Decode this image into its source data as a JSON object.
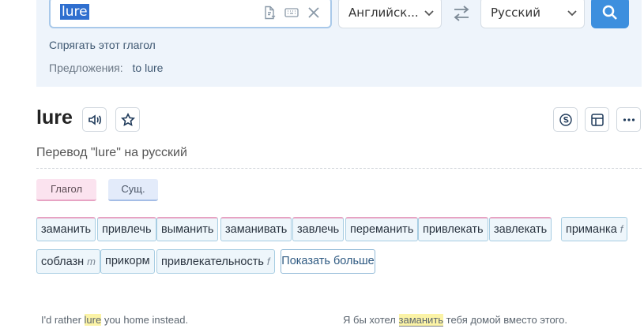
{
  "search": {
    "query": "lure",
    "source_lang": "Английск...",
    "target_lang": "Русский",
    "conjugate_link": "Спрягать этот глагол",
    "suggestions_label": "Предложения:",
    "suggestion": "to lure"
  },
  "entry": {
    "word": "lure",
    "subtitle": "Перевод \"lure\" на русский"
  },
  "pos": {
    "verb": "Глагол",
    "noun": "Сущ."
  },
  "translations": [
    {
      "text": "заманить",
      "pos": "verb"
    },
    {
      "text": "привлечь",
      "pos": "verb"
    },
    {
      "text": "выманить",
      "pos": "verb"
    },
    {
      "text": "заманивать",
      "pos": "verb"
    },
    {
      "text": "завлечь",
      "pos": "verb"
    },
    {
      "text": "переманить",
      "pos": "verb"
    },
    {
      "text": "привлекать",
      "pos": "verb"
    },
    {
      "text": "завлекать",
      "pos": "verb"
    },
    {
      "text": "приманка",
      "pos": "noun",
      "gender": "f"
    },
    {
      "text": "соблазн",
      "pos": "noun",
      "gender": "m"
    },
    {
      "text": "прикорм",
      "pos": "noun"
    },
    {
      "text": "привлекательность",
      "pos": "noun",
      "gender": "f"
    }
  ],
  "more_button": "Показать больше",
  "example": {
    "src_before": "I'd rather ",
    "src_hl": "lure",
    "src_after": " you home instead.",
    "tgt_before": "Я бы хотел ",
    "tgt_hl": "заманить",
    "tgt_after": " тебя домой вместо этого."
  },
  "colors": {
    "accent": "#3d8fde",
    "verb": "#e7a3c3",
    "noun": "#a4bde6",
    "highlight": "#fbf3a6"
  }
}
